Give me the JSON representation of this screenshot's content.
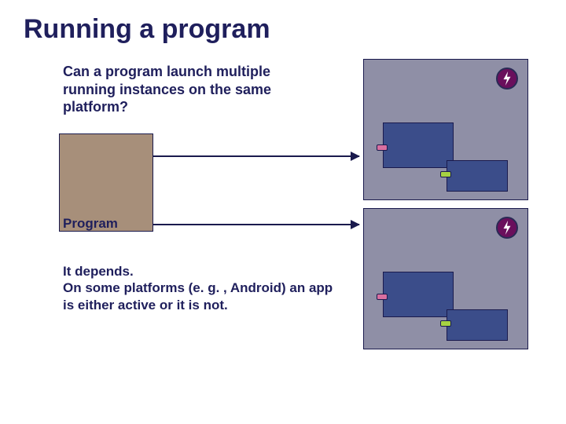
{
  "title": "Running a program",
  "question": "Can a program launch multiple running instances on the same platform?",
  "program_label": "Program",
  "answer_line1": "It depends.",
  "answer_line2": "On some platforms (e. g. , Android) an app is either active or it is not.",
  "icons": {
    "cpu": "lightning-icon"
  },
  "colors": {
    "title": "#1f1f5c",
    "program_box": "#a78f7a",
    "instance_box": "#8f8fa6",
    "inner_block": "#3b4d8a",
    "cpu_circle": "#6a0f5c",
    "hinge_pink": "#d96fa0",
    "hinge_green": "#a6d242"
  }
}
